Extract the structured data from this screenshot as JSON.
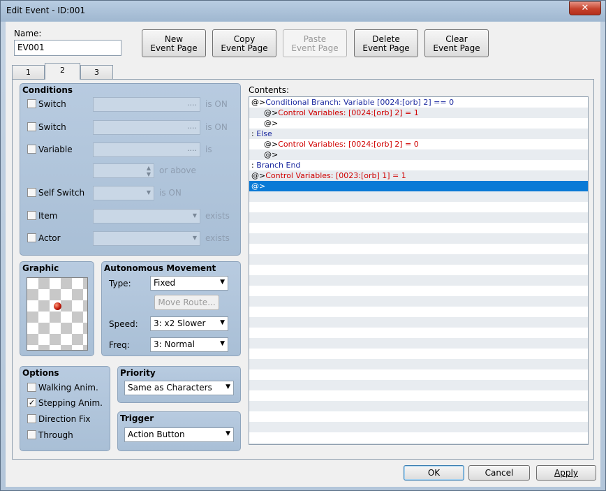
{
  "window": {
    "title": "Edit Event - ID:001",
    "close_glyph": "✕"
  },
  "name_field": {
    "label": "Name:",
    "value": "EV001"
  },
  "page_buttons": [
    {
      "line1": "New",
      "line2": "Event Page",
      "enabled": true
    },
    {
      "line1": "Copy",
      "line2": "Event Page",
      "enabled": true
    },
    {
      "line1": "Paste",
      "line2": "Event Page",
      "enabled": false
    },
    {
      "line1": "Delete",
      "line2": "Event Page",
      "enabled": true
    },
    {
      "line1": "Clear",
      "line2": "Event Page",
      "enabled": true
    }
  ],
  "tabs": [
    "1",
    "2",
    "3"
  ],
  "active_tab": "2",
  "conditions": {
    "title": "Conditions",
    "switch1": {
      "label": "Switch",
      "suffix": "is ON",
      "checked": false
    },
    "switch2": {
      "label": "Switch",
      "suffix": "is ON",
      "checked": false
    },
    "variable": {
      "label": "Variable",
      "suffix": "is",
      "suffix2": "or above",
      "checked": false
    },
    "self_switch": {
      "label": "Self Switch",
      "suffix": "is ON",
      "checked": false
    },
    "item": {
      "label": "Item",
      "suffix": "exists",
      "checked": false
    },
    "actor": {
      "label": "Actor",
      "suffix": "exists",
      "checked": false
    },
    "ellipsis": "...."
  },
  "graphic": {
    "title": "Graphic",
    "icon": "orb-sprite-icon"
  },
  "autonomous": {
    "title": "Autonomous Movement",
    "type_label": "Type:",
    "type_value": "Fixed",
    "move_route": "Move Route...",
    "speed_label": "Speed:",
    "speed_value": "3: x2 Slower",
    "freq_label": "Freq:",
    "freq_value": "3: Normal"
  },
  "options": {
    "title": "Options",
    "items": [
      {
        "label": "Walking Anim.",
        "checked": false
      },
      {
        "label": "Stepping Anim.",
        "checked": true
      },
      {
        "label": "Direction Fix",
        "checked": false
      },
      {
        "label": "Through",
        "checked": false
      }
    ]
  },
  "priority": {
    "title": "Priority",
    "value": "Same as Characters"
  },
  "trigger": {
    "title": "Trigger",
    "value": "Action Button"
  },
  "contents": {
    "label": "Contents:",
    "lines": [
      {
        "prefix": "@>",
        "text": "Conditional Branch: Variable [0024:[orb] 2] == 0",
        "color": "blue",
        "indent": 0
      },
      {
        "prefix": "@>",
        "text": "Control Variables: [0024:[orb] 2] = 1",
        "color": "red",
        "indent": 1
      },
      {
        "prefix": "@>",
        "text": "",
        "color": "black",
        "indent": 1
      },
      {
        "prefix": " : ",
        "text": "Else",
        "color": "blue",
        "indent": 0
      },
      {
        "prefix": "@>",
        "text": "Control Variables: [0024:[orb] 2] = 0",
        "color": "red",
        "indent": 1
      },
      {
        "prefix": "@>",
        "text": "",
        "color": "black",
        "indent": 1
      },
      {
        "prefix": " : ",
        "text": "Branch End",
        "color": "blue",
        "indent": 0
      },
      {
        "prefix": "@>",
        "text": "Control Variables: [0023:[orb] 1] = 1",
        "color": "red",
        "indent": 0
      },
      {
        "prefix": "@>",
        "text": "",
        "color": "black",
        "indent": 0,
        "selected": true
      }
    ]
  },
  "footer": {
    "ok": "OK",
    "cancel": "Cancel",
    "apply": "Apply"
  },
  "colors": {
    "selection": "#0a7ad6",
    "command_blue": "#1c2aa0",
    "command_red": "#d00000"
  }
}
